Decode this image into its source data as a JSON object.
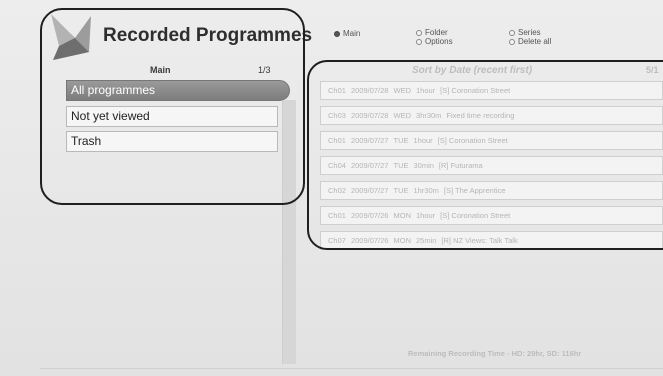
{
  "header": {
    "title": "Recorded Programmes",
    "logo_icon": "satellite-dish-icon",
    "options": [
      {
        "label": "Main",
        "selected": true
      },
      {
        "label": "Folder",
        "selected": false
      },
      {
        "label": "Series",
        "selected": false
      },
      {
        "label": "Options",
        "selected": false
      },
      {
        "label": "Delete all",
        "selected": false
      }
    ]
  },
  "sidebar": {
    "heading": "Main",
    "page": "1/3",
    "items": [
      {
        "label": "All programmes",
        "selected": true
      },
      {
        "label": "Not yet viewed",
        "selected": false
      },
      {
        "label": "Trash",
        "selected": false
      }
    ]
  },
  "recordings": {
    "heading": "Sort by Date (recent first)",
    "page": "5/1",
    "rows": [
      {
        "channel": "Ch01",
        "date": "2009/07/28",
        "day": "WED",
        "duration": "1hour",
        "title": "[S] Coronation Street"
      },
      {
        "channel": "Ch03",
        "date": "2009/07/28",
        "day": "WED",
        "duration": "3hr30m",
        "title": "Fixed time recording"
      },
      {
        "channel": "Ch01",
        "date": "2009/07/27",
        "day": "TUE",
        "duration": "1hour",
        "title": "[S] Coronation Street"
      },
      {
        "channel": "Ch04",
        "date": "2009/07/27",
        "day": "TUE",
        "duration": "30min",
        "title": "[R] Futurama"
      },
      {
        "channel": "Ch02",
        "date": "2009/07/27",
        "day": "TUE",
        "duration": "1hr30m",
        "title": "[S] The Apprentice"
      },
      {
        "channel": "Ch01",
        "date": "2009/07/26",
        "day": "MON",
        "duration": "1hour",
        "title": "[S] Coronation Street"
      },
      {
        "channel": "Ch07",
        "date": "2009/07/26",
        "day": "MON",
        "duration": "25min",
        "title": "[R] NZ Views: Talk Talk"
      }
    ]
  },
  "footer": {
    "remaining": "Remaining Recording Time - HD: 29hr, SD: 116hr"
  }
}
